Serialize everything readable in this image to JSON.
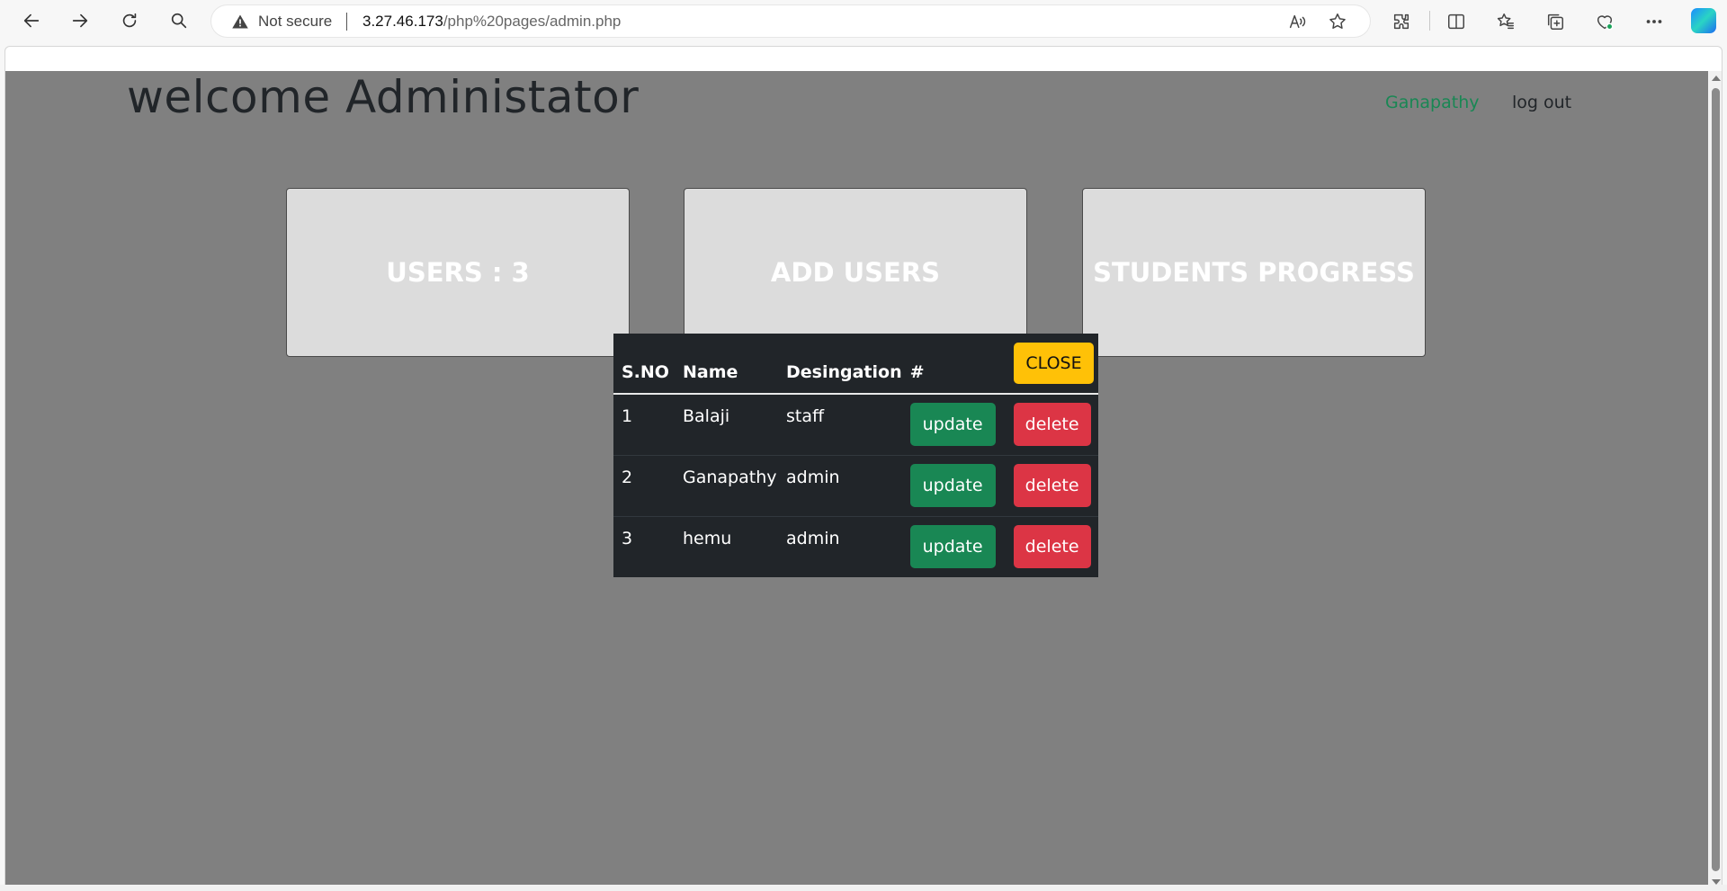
{
  "browser": {
    "security_label": "Not secure",
    "url_host": "3.27.46.173",
    "url_path": "/php%20pages/admin.php",
    "icons": [
      "back-icon",
      "forward-icon",
      "refresh-icon",
      "search-icon",
      "warning-icon",
      "read-aloud-icon",
      "favorite-star-icon",
      "extensions-icon",
      "split-screen-icon",
      "favorites-icon",
      "collections-icon",
      "browser-essentials-icon",
      "more-icon",
      "copilot-icon"
    ]
  },
  "page": {
    "title": "welcome Administator",
    "nav": {
      "user_link": "Ganapathy",
      "logout_link": "log out"
    },
    "cards": [
      {
        "label": "USERS : 3"
      },
      {
        "label": "ADD USERS"
      },
      {
        "label": "STUDENTS PROGRESS"
      }
    ]
  },
  "modal": {
    "close_label": "CLOSE",
    "columns": [
      "S.NO",
      "Name",
      "Desingation",
      "#"
    ],
    "rows": [
      {
        "sno": "1",
        "name": "Balaji",
        "designation": "staff",
        "update": "update",
        "delete": "delete"
      },
      {
        "sno": "2",
        "name": "Ganapathy",
        "designation": "admin",
        "update": "update",
        "delete": "delete"
      },
      {
        "sno": "3",
        "name": "hemu",
        "designation": "admin",
        "update": "update",
        "delete": "delete"
      }
    ]
  },
  "colors": {
    "page_bg": "#808080",
    "card_bg": "#dcdcdc",
    "modal_bg": "#212529",
    "update_green": "#198754",
    "delete_red": "#dc3545",
    "close_yellow": "#ffc107",
    "nav_user_green": "#198754"
  }
}
